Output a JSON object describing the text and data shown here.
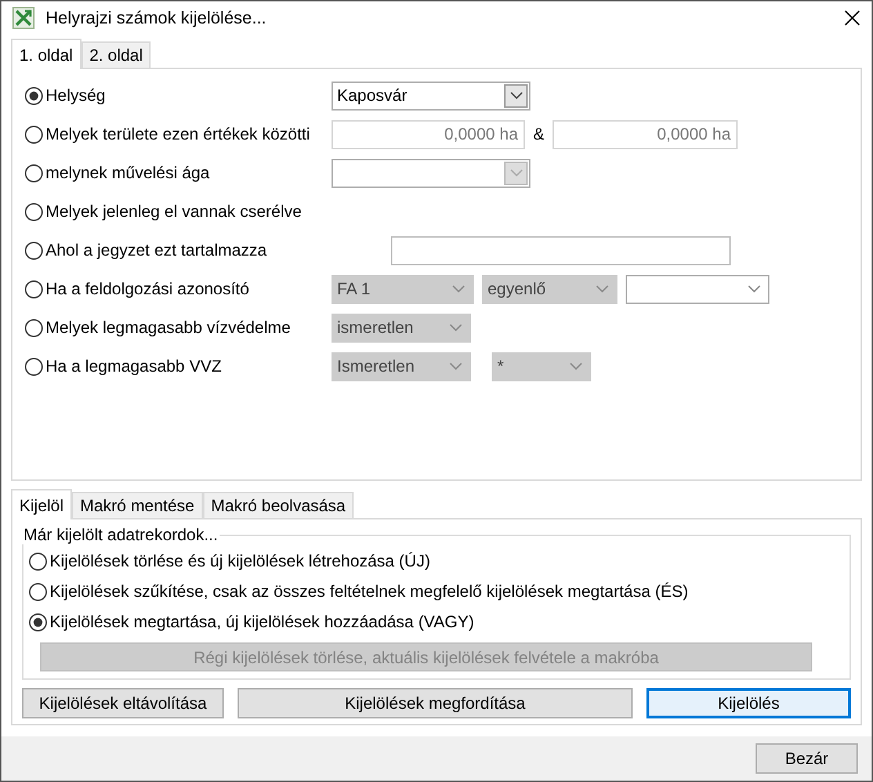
{
  "window": {
    "title": "Helyrajzi számok kijelölése..."
  },
  "page_tabs": [
    {
      "label": "1. oldal",
      "selected": true
    },
    {
      "label": "2. oldal",
      "selected": false
    }
  ],
  "criteria": [
    {
      "label": "Helység",
      "selected": true,
      "controls": [
        {
          "kind": "dropdown",
          "value": "Kaposvár",
          "disabled": false
        }
      ]
    },
    {
      "label": "Melyek területe ezen értékek közötti",
      "selected": false,
      "controls": [
        {
          "kind": "field",
          "value": "0,0000 ha",
          "disabled": true
        },
        {
          "kind": "sep",
          "text": "&"
        },
        {
          "kind": "field",
          "value": "0,0000 ha",
          "disabled": true
        }
      ]
    },
    {
      "label": "melynek művelési ága",
      "selected": false,
      "controls": [
        {
          "kind": "dropdown",
          "disabled": true
        }
      ]
    },
    {
      "label": "Melyek jelenleg el vannak cserélve",
      "selected": false
    },
    {
      "label": "Ahol a jegyzet ezt tartalmazza",
      "selected": false,
      "controls": [
        {
          "kind": "field",
          "disabled": false
        }
      ]
    },
    {
      "label": "Ha a feldolgozási azonosító",
      "selected": false,
      "controls": [
        {
          "kind": "combo",
          "value": "FA 1",
          "disabled": true
        },
        {
          "kind": "combo",
          "value": "egyenlő",
          "disabled": true
        },
        {
          "kind": "combo",
          "disabled": false
        }
      ]
    },
    {
      "label": "Melyek legmagasabb vízvédelme",
      "selected": false,
      "controls": [
        {
          "kind": "combo",
          "value": "ismeretlen",
          "disabled": true
        }
      ]
    },
    {
      "label": "Ha a legmagasabb VVZ",
      "selected": false,
      "controls": [
        {
          "kind": "combo",
          "value": "Ismeretlen",
          "disabled": true
        },
        {
          "kind": "combo",
          "value": "*",
          "disabled": true
        }
      ]
    }
  ],
  "action_tabs": [
    {
      "label": "Kijelöl",
      "selected": true
    },
    {
      "label": "Makró mentése",
      "selected": false
    },
    {
      "label": "Makró beolvasása",
      "selected": false
    }
  ],
  "group": {
    "title": "Már kijelölt adatrekordok...",
    "options": [
      {
        "label": "Kijelölések törlése és új kijelölések létrehozása (ÚJ)",
        "selected": false
      },
      {
        "label": "Kijelölések szűkítése, csak az összes feltételnek megfelelő kijelölések megtartása (ÉS)",
        "selected": false
      },
      {
        "label": "Kijelölések megtartása, új kijelölések hozzáadása (VAGY)",
        "selected": true
      }
    ],
    "macro_button": {
      "label": "Régi kijelölések törlése, aktuális kijelölések felvétele a makróba",
      "disabled": true
    }
  },
  "buttons": [
    {
      "label": "Kijelölések eltávolítása",
      "default": false
    },
    {
      "label": "Kijelölések megfordítása",
      "default": false
    },
    {
      "label": "Kijelölés",
      "default": true
    }
  ],
  "close_button": {
    "label": "Bezár"
  }
}
